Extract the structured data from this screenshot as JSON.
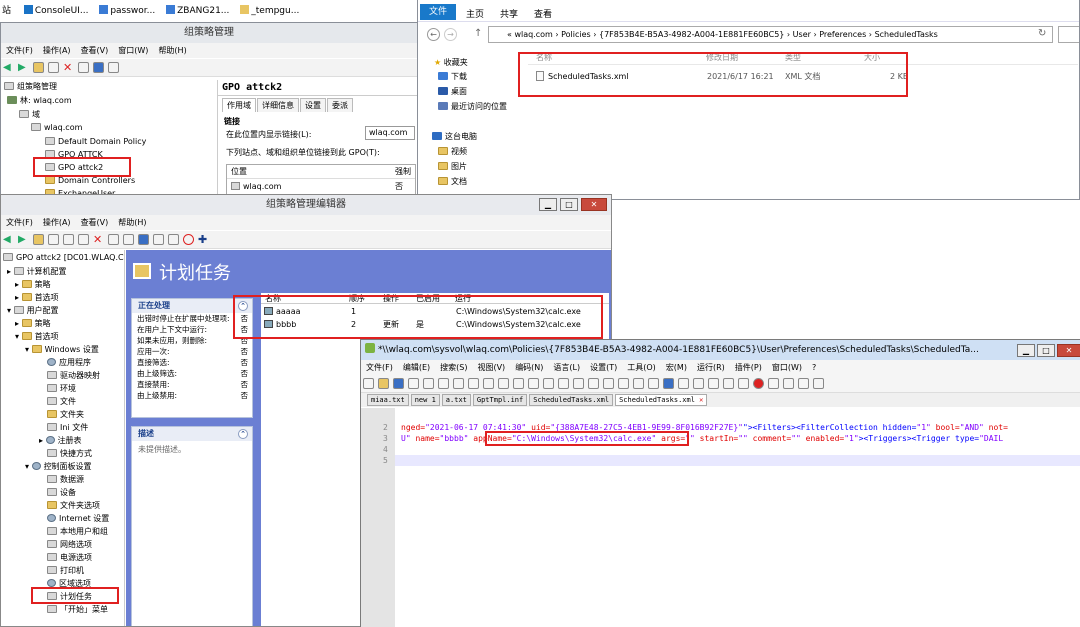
{
  "taskbar": {
    "items": [
      "站",
      "ConsoleUI...",
      "passwor...",
      "ZBANG21...",
      "_tempgu..."
    ]
  },
  "gpmc": {
    "title": "组策略管理",
    "menu": [
      "文件(F)",
      "操作(A)",
      "查看(V)",
      "窗口(W)",
      "帮助(H)"
    ],
    "tree": {
      "root": "组策略管理",
      "forest": "林: wlaq.com",
      "domains": "域",
      "domain": "wlaq.com",
      "items": [
        "Default Domain Policy",
        "GPO ATTCK",
        "GPO attck2",
        "Domain Controllers",
        "ExchangeUser"
      ]
    },
    "detail": {
      "title": "GPO attck2",
      "tabs": [
        "作用域",
        "详细信息",
        "设置",
        "委派"
      ],
      "section": "链接",
      "location_label": "在此位置内显示链接(L):",
      "location_value": "wlaq.com",
      "linked_label": "下列站点、域和组织单位链接到此 GPO(T):",
      "col_location": "位置",
      "col_enforced": "强制",
      "row_location": "wlaq.com",
      "row_enforced": "否"
    }
  },
  "explorer": {
    "ribbon": [
      "文件",
      "主页",
      "共享",
      "查看"
    ],
    "path": [
      "« wlaq.com",
      "Policies",
      "{7F853B4E-B5A3-4982-A004-1E881FE60BC5}",
      "User",
      "Preferences",
      "ScheduledTasks"
    ],
    "nav": [
      "收藏夹",
      "下载",
      "桌面",
      "最近访问的位置",
      "这台电脑",
      "视频",
      "图片",
      "文档"
    ],
    "columns": [
      "名称",
      "修改日期",
      "类型",
      "大小"
    ],
    "file": {
      "name": "ScheduledTasks.xml",
      "date": "2021/6/17 16:21",
      "type": "XML 文档",
      "size": "2 KB"
    }
  },
  "gpme": {
    "title": "组策略管理编辑器",
    "menu": [
      "文件(F)",
      "操作(A)",
      "查看(V)",
      "帮助(H)"
    ],
    "tree": [
      "GPO attck2 [DC01.WLAQ.COM]",
      "计算机配置",
      "策略",
      "首选项",
      "用户配置",
      "策略",
      "首选项",
      "Windows 设置",
      "应用程序",
      "驱动器映射",
      "环境",
      "文件",
      "文件夹",
      "Ini 文件",
      "注册表",
      "快捷方式",
      "控制面板设置",
      "数据源",
      "设备",
      "文件夹选项",
      "Internet 设置",
      "本地用户和组",
      "网络选项",
      "电源选项",
      "打印机",
      "区域选项",
      "计划任务",
      "「开始」菜单"
    ],
    "header": "计划任务",
    "processing": {
      "title": "正在处理",
      "rows": [
        [
          "出错时停止在扩展中处理项:",
          "否"
        ],
        [
          "在用户上下文中运行:",
          "否"
        ],
        [
          "如果未应用，则删除:",
          "否"
        ],
        [
          "应用一次:",
          "否"
        ],
        [
          "直接筛选:",
          "否"
        ],
        [
          "由上级筛选:",
          "否"
        ],
        [
          "直接禁用:",
          "否"
        ],
        [
          "由上级禁用:",
          "否"
        ]
      ]
    },
    "desc": {
      "title": "描述",
      "text": "未提供描述。"
    },
    "columns": [
      "名称",
      "顺序",
      "操作",
      "已启用",
      "运行"
    ],
    "rows": [
      {
        "name": "aaaaa",
        "order": "1",
        "action": "",
        "enabled": "",
        "run": "C:\\Windows\\System32\\calc.exe"
      },
      {
        "name": "bbbb",
        "order": "2",
        "action": "更新",
        "enabled": "是",
        "run": "C:\\Windows\\System32\\calc.exe"
      }
    ]
  },
  "npp": {
    "title": "*\\\\wlaq.com\\sysvol\\wlaq.com\\Policies\\{7F853B4E-B5A3-4982-A004-1E881FE60BC5}\\User\\Preferences\\ScheduledTasks\\ScheduledTa...",
    "menu": [
      "文件(F)",
      "编辑(E)",
      "搜索(S)",
      "视图(V)",
      "编码(N)",
      "语言(L)",
      "设置(T)",
      "工具(O)",
      "宏(M)",
      "运行(R)",
      "插件(P)",
      "窗口(W)",
      "?"
    ],
    "tabs": [
      "miaa.txt",
      "new 1",
      "a.txt",
      "GptTmpl.inf",
      "ScheduledTasks.xml",
      "ScheduledTasks.xml"
    ],
    "lines": [
      "2",
      "3",
      "4",
      "5"
    ],
    "line2": {
      "a": "nged=",
      "b": "\"2021-06-17 07:41:30\"",
      "c": " uid=",
      "d": "\"{388A7E48-27C5-4EB1-9E99-8F016B92F27E}\"",
      "e": "\"><Filters><FilterCollection hidden=",
      "f": "\"1\"",
      "g": " bool=",
      "h": "\"AND\"",
      "i": " not="
    },
    "line3": {
      "a": "U\"",
      "b": " name=",
      "c": "\"bbbb\"",
      "d": " appName=",
      "e": "\"C:\\Windows\\System32\\calc.exe\"",
      "f": " args=",
      "g": "\"\"",
      "h": " startIn=",
      "i": "\"\"",
      "j": " comment=",
      "k": "\"\"",
      "l": " enabled=",
      "m": "\"1\"",
      "n": "><Triggers><Trigger type=",
      "o": "\"DAIL"
    }
  }
}
